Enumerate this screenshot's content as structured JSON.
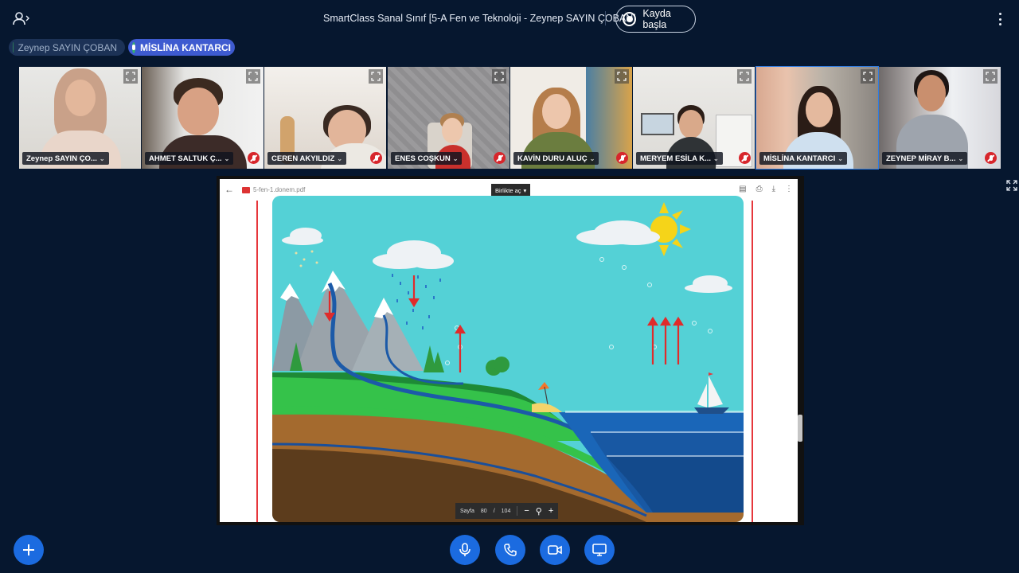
{
  "header": {
    "title": "SmartClass Sanal Sınıf [5-A Fen ve Teknoloji - Zeynep SAYIN ÇOBAN]",
    "record_label": "Kayda başla"
  },
  "speakers": [
    {
      "name": "Zeynep SAYIN ÇOBAN",
      "talking": false
    },
    {
      "name": "MİSLİNA KANTARCI",
      "talking": true
    }
  ],
  "participants": [
    {
      "name": "Zeynep SAYIN ÇO...",
      "muted": false
    },
    {
      "name": "AHMET SALTUK Ç...",
      "muted": true
    },
    {
      "name": "CEREN AKYILDIZ",
      "muted": true
    },
    {
      "name": "ENES COŞKUN",
      "muted": true
    },
    {
      "name": "KAVİN DURU ALUÇ",
      "muted": true
    },
    {
      "name": "MERYEM ESİLA K...",
      "muted": true
    },
    {
      "name": "MİSLİNA KANTARCI",
      "muted": false,
      "active": true
    },
    {
      "name": "ZEYNEP MİRAY B...",
      "muted": true
    }
  ],
  "pdf_viewer": {
    "file_name": "5-fen-1.donem.pdf",
    "open_with_label": "Birlikte aç",
    "page_label": "Sayfa",
    "current_page": "80",
    "total_pages": "104",
    "page_separator": "/"
  },
  "colors": {
    "background": "#06172f",
    "accent": "#1b6be0",
    "active_speaker": "#3e5bd0",
    "muted": "#d7262c"
  }
}
